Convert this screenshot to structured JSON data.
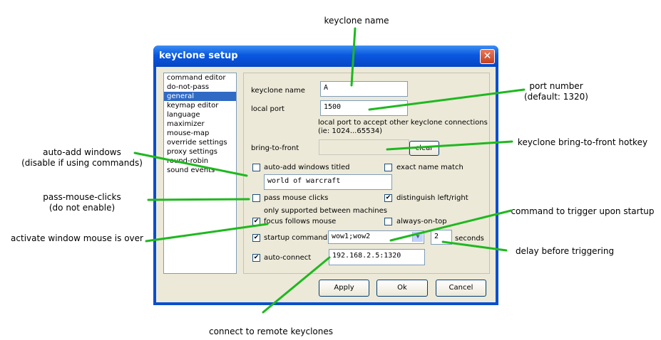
{
  "annotations": {
    "keyclone_name": "keyclone name",
    "port_number": "port number",
    "port_default": "(default: 1320)",
    "bring_to_front": "keyclone bring-to-front hotkey",
    "auto_add": "auto-add windows",
    "auto_add_note": "(disable if using commands)",
    "pass_clicks": "pass-mouse-clicks",
    "pass_clicks_note": "(do not enable)",
    "activate_window": "activate window mouse is over",
    "startup_cmd": "command to trigger upon startup",
    "delay": "delay before triggering",
    "connect": "connect to remote keyclones"
  },
  "dialog": {
    "title": "keyclone setup",
    "close_glyph": "✕"
  },
  "sidebar": {
    "items": [
      {
        "label": "command editor",
        "selected": false
      },
      {
        "label": "do-not-pass",
        "selected": false
      },
      {
        "label": "general",
        "selected": true
      },
      {
        "label": "keymap editor",
        "selected": false
      },
      {
        "label": "language",
        "selected": false
      },
      {
        "label": "maximizer",
        "selected": false
      },
      {
        "label": "mouse-map",
        "selected": false
      },
      {
        "label": "override settings",
        "selected": false
      },
      {
        "label": "proxy settings",
        "selected": false
      },
      {
        "label": "round-robin",
        "selected": false
      },
      {
        "label": "sound events",
        "selected": false
      }
    ]
  },
  "general": {
    "name_label": "keyclone name",
    "name_value": "A",
    "port_label": "local port",
    "port_value": "1500",
    "port_help1": "local port to accept other keyclone connections",
    "port_help2": "(ie: 1024...65534)",
    "btf_label": "bring-to-front",
    "btf_value": "",
    "clear_label": "clear",
    "auto_add_label": "auto-add windows titled",
    "auto_add_checked": "",
    "exact_label": "exact name match",
    "exact_checked": "",
    "window_title_value": "world of warcraft",
    "pass_label": "pass mouse clicks",
    "pass_checked": "",
    "distinguish_label": "distinguish left/right",
    "distinguish_checked": "✔",
    "pass_note": "only supported between machines",
    "focus_label": "focus follows mouse",
    "focus_checked": "✔",
    "ontop_label": "always-on-top",
    "ontop_checked": "",
    "startup_label": "startup command",
    "startup_checked": "✔",
    "startup_value": "wow1;wow2",
    "combo_arrow": "▼",
    "seconds_value": "2",
    "seconds_label": "seconds",
    "autoconnect_label": "auto-connect",
    "autoconnect_checked": "✔",
    "autoconnect_value": "192.168.2.5:1320"
  },
  "buttons": {
    "apply": "Apply",
    "ok": "Ok",
    "cancel": "Cancel"
  },
  "colors": {
    "callout_line": "#1fb81f",
    "title_bar": "#0a58e0",
    "selection": "#316ac5"
  }
}
